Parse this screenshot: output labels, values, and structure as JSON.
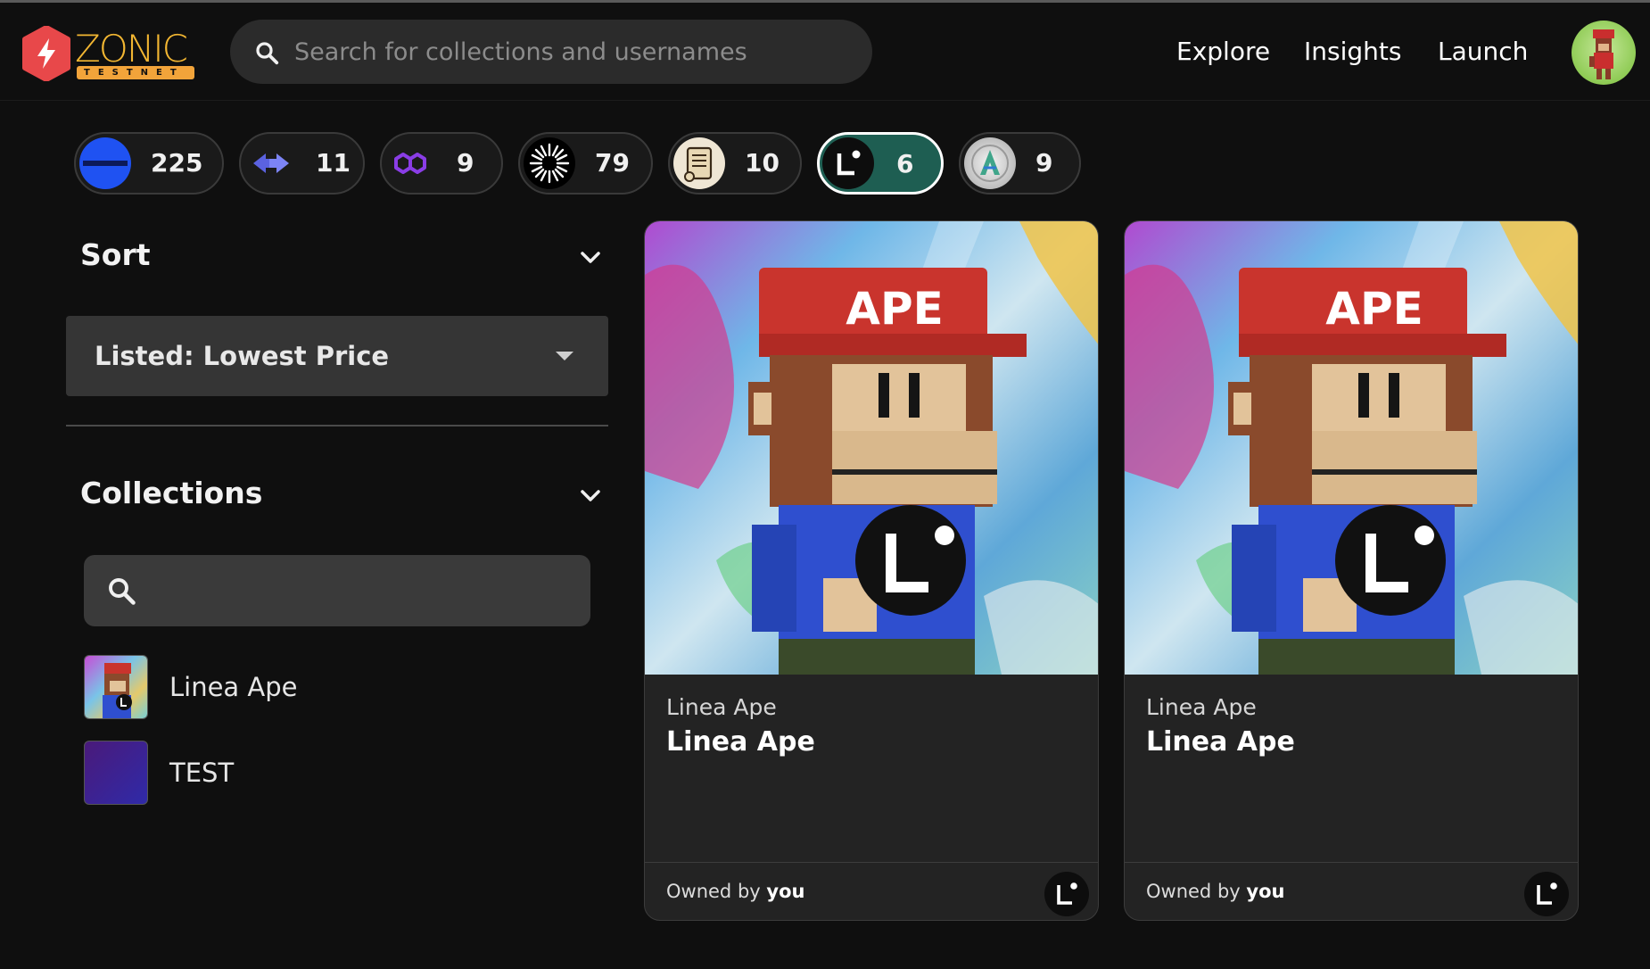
{
  "app": {
    "logo_text": "ZONIC",
    "logo_subtext": "TESTNET"
  },
  "search": {
    "placeholder": "Search for collections and usernames",
    "icon": "search-icon"
  },
  "nav": {
    "explore": "Explore",
    "insights": "Insights",
    "launch": "Launch"
  },
  "chains": [
    {
      "icon": "linea-blue-icon",
      "count": "225",
      "active": false
    },
    {
      "icon": "arbitrum-nova-icon",
      "count": "11",
      "active": false
    },
    {
      "icon": "polygon-icon",
      "count": "9",
      "active": false
    },
    {
      "icon": "sunburst-chain-icon",
      "count": "79",
      "active": false
    },
    {
      "icon": "scroll-icon",
      "count": "10",
      "active": false
    },
    {
      "icon": "linea-icon",
      "count": "6",
      "active": true
    },
    {
      "icon": "astar-icon",
      "count": "9",
      "active": false
    }
  ],
  "sidebar": {
    "sort_title": "Sort",
    "sort_value": "Listed: Lowest Price",
    "collections_title": "Collections",
    "collection_search_value": "",
    "collections": [
      {
        "label": "Linea Ape"
      },
      {
        "label": "TEST"
      }
    ]
  },
  "cards": [
    {
      "collection": "Linea Ape",
      "name": "Linea Ape",
      "owner_prefix": "Owned by",
      "owner": "you",
      "hat_text": "APE"
    },
    {
      "collection": "Linea Ape",
      "name": "Linea Ape",
      "owner_prefix": "Owned by",
      "owner": "you",
      "hat_text": "APE"
    }
  ],
  "colors": {
    "background": "#0f0f0f",
    "accent_logo": "#f2b632",
    "active_chip": "#1e5e52",
    "card_bg": "#232323"
  }
}
